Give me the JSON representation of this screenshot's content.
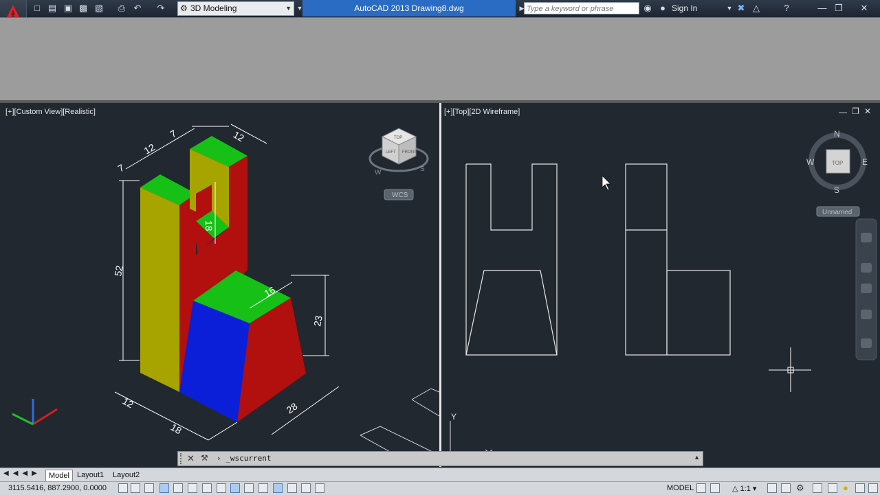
{
  "titlebar": {
    "workspace": "3D Modeling",
    "doc_title": "AutoCAD 2013    Drawing8.dwg",
    "search_placeholder": "Type a keyword or phrase",
    "signin": "Sign In"
  },
  "viewports": {
    "left_label": "[+][Custom View][Realistic]",
    "right_label": "[+][Top][2D Wireframe]",
    "wcs_label": "WCS",
    "unnamed_label": "Unnamed",
    "compass": {
      "n": "N",
      "s": "S",
      "e": "E",
      "w": "W",
      "top": "TOP"
    },
    "cube_faces": {
      "top": "TOP",
      "left": "LEFT",
      "front": "FRONT"
    },
    "cube_compass": {
      "w": "W",
      "s": "S"
    },
    "ucs": {
      "y": "Y"
    }
  },
  "dimensions": [
    "7",
    "12",
    "7",
    "12",
    "18",
    "52",
    "16",
    "23",
    "12",
    "18",
    "28"
  ],
  "command": {
    "text": "_wscurrent"
  },
  "tabs": [
    "Model",
    "Layout1",
    "Layout2"
  ],
  "status": {
    "coords": "3115.5416, 887.2900, 0.0000",
    "model": "MODEL",
    "scale": "1:1"
  },
  "colors": {
    "green": "#16c016",
    "yellow": "#a7a400",
    "red": "#b20f0f",
    "blue": "#0c1fd8",
    "accent": "#2a6bc3"
  }
}
